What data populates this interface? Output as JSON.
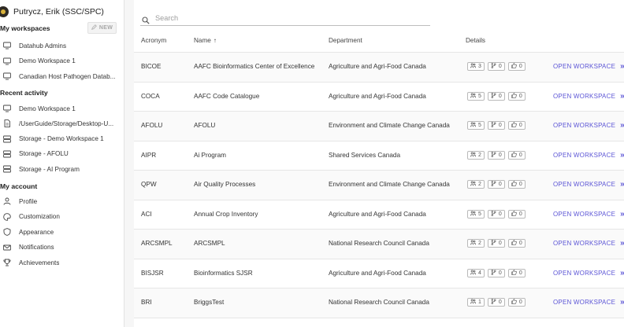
{
  "user": {
    "name": "Putrycz, Erik (SSC/SPC)"
  },
  "sidebar": {
    "workspaces_title": "My workspaces",
    "new_label": "NEW",
    "workspaces": [
      {
        "label": "Datahub Admins",
        "icon": "monitor-icon"
      },
      {
        "label": "Demo Workspace 1",
        "icon": "monitor-icon"
      },
      {
        "label": "Canadian Host Pathogen Datab...",
        "icon": "monitor-icon"
      }
    ],
    "recent_title": "Recent activity",
    "recent": [
      {
        "label": "Demo Workspace 1",
        "icon": "monitor-icon"
      },
      {
        "label": "/UserGuide/Storage/Desktop-U...",
        "icon": "file-icon"
      },
      {
        "label": "Storage - Demo Workspace 1",
        "icon": "storage-icon"
      },
      {
        "label": "Storage - AFOLU",
        "icon": "storage-icon"
      },
      {
        "label": "Storage - AI Program",
        "icon": "storage-icon"
      }
    ],
    "account_title": "My account",
    "account": [
      {
        "label": "Profile",
        "icon": "person-icon"
      },
      {
        "label": "Customization",
        "icon": "palette-icon"
      },
      {
        "label": "Appearance",
        "icon": "shield-icon"
      },
      {
        "label": "Notifications",
        "icon": "mail-icon"
      },
      {
        "label": "Achievements",
        "icon": "trophy-icon"
      }
    ]
  },
  "search": {
    "placeholder": "Search"
  },
  "table": {
    "headers": {
      "acronym": "Acronym",
      "name": "Name",
      "department": "Department",
      "details": "Details"
    },
    "open_label": "OPEN WORKSPACE",
    "rows": [
      {
        "acronym": "BICOE",
        "name": "AAFC Bioinformatics Center of Excellence",
        "department": "Agriculture and Agri-Food Canada",
        "members": "3",
        "branches": "0",
        "likes": "0"
      },
      {
        "acronym": "COCA",
        "name": "AAFC Code Catalogue",
        "department": "Agriculture and Agri-Food Canada",
        "members": "5",
        "branches": "0",
        "likes": "0"
      },
      {
        "acronym": "AFOLU",
        "name": "AFOLU",
        "department": "Environment and Climate Change Canada",
        "members": "5",
        "branches": "0",
        "likes": "0"
      },
      {
        "acronym": "AIPR",
        "name": "Ai Program",
        "department": "Shared Services Canada",
        "members": "2",
        "branches": "0",
        "likes": "0"
      },
      {
        "acronym": "QPW",
        "name": "Air Quality Processes",
        "department": "Environment and Climate Change Canada",
        "members": "2",
        "branches": "0",
        "likes": "0"
      },
      {
        "acronym": "ACI",
        "name": "Annual Crop Inventory",
        "department": "Agriculture and Agri-Food Canada",
        "members": "5",
        "branches": "0",
        "likes": "0"
      },
      {
        "acronym": "ARCSMPL",
        "name": "ARCSMPL",
        "department": "National Research Council Canada",
        "members": "2",
        "branches": "0",
        "likes": "0"
      },
      {
        "acronym": "BISJSR",
        "name": "Bioinformatics SJSR",
        "department": "Agriculture and Agri-Food Canada",
        "members": "4",
        "branches": "0",
        "likes": "0"
      },
      {
        "acronym": "BRI",
        "name": "BriggsTest",
        "department": "National Research Council Canada",
        "members": "1",
        "branches": "0",
        "likes": "0"
      }
    ]
  }
}
